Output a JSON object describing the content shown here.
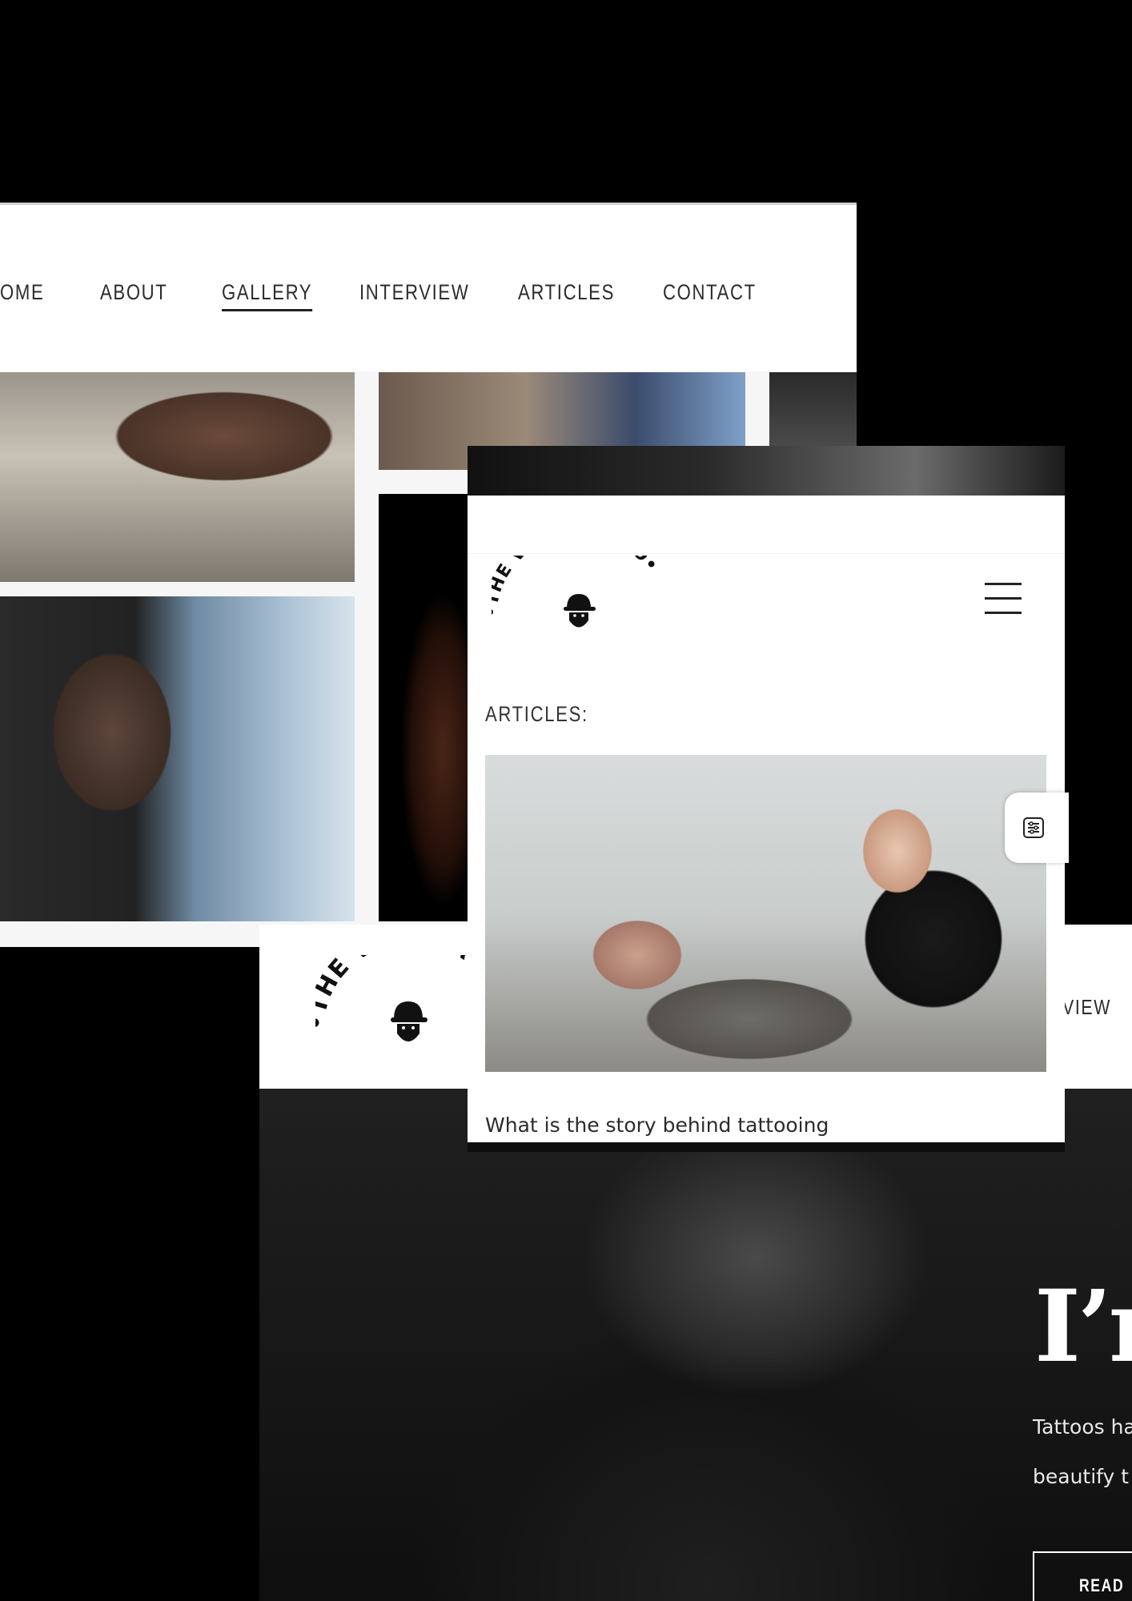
{
  "gallery_site": {
    "nav": [
      {
        "label": "OME",
        "active": false
      },
      {
        "label": "ABOUT",
        "active": false
      },
      {
        "label": "GALLERY",
        "active": true
      },
      {
        "label": "INTERVIEW",
        "active": false
      },
      {
        "label": "ARTICLES",
        "active": false
      },
      {
        "label": "CONTACT",
        "active": false
      }
    ]
  },
  "home_site": {
    "logo_text": "•THE VOID TA",
    "nav_tail": "VIEW",
    "hero": {
      "title": "I’r",
      "text_lines": [
        "Tattoos ha",
        "beautify t"
      ],
      "button_label": "READ"
    }
  },
  "mobile_site": {
    "logo_text": "•THE VOID TATTOO•",
    "menu_icon": "hamburger-menu-icon",
    "section_label": "ARTICLES:",
    "article_title": "What is the story behind tattooing",
    "settings_icon": "sliders-settings-icon"
  },
  "colors": {
    "background": "#000000",
    "panel": "#ffffff",
    "text_dark": "#2b2b2b"
  }
}
